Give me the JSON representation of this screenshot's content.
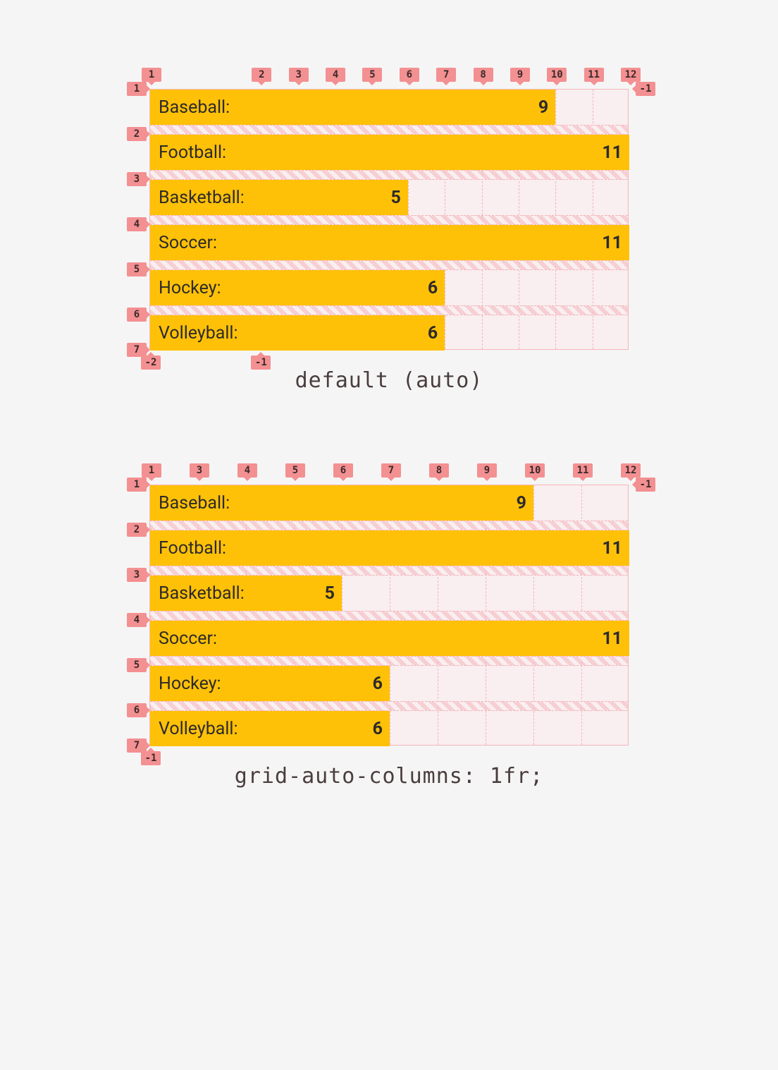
{
  "rows": [
    {
      "label": "Baseball:",
      "value": 9
    },
    {
      "label": "Football:",
      "value": 11
    },
    {
      "label": "Basketball:",
      "value": 5
    },
    {
      "label": "Soccer:",
      "value": 11
    },
    {
      "label": "Hockey:",
      "value": 6
    },
    {
      "label": "Volleyball:",
      "value": 6
    }
  ],
  "max_value": 11,
  "captions": {
    "auto": "default (auto)",
    "fr": "grid-auto-columns: 1fr;"
  },
  "diagrams": {
    "auto": {
      "label_frac": 0.23,
      "top_ticks": [
        1,
        2,
        3,
        4,
        5,
        6,
        7,
        8,
        9,
        10,
        11,
        12
      ],
      "left_ticks": [
        1,
        2,
        3,
        4,
        5,
        6,
        7
      ],
      "right_ticks": [
        -1
      ],
      "bottom_ticks": [
        -2,
        -1
      ]
    },
    "fr": {
      "label_frac": 0,
      "top_ticks": [
        1,
        3,
        4,
        5,
        6,
        7,
        8,
        9,
        10,
        11,
        12
      ],
      "left_ticks": [
        1,
        2,
        3,
        4,
        5,
        6,
        7
      ],
      "right_ticks": [
        -1
      ],
      "bottom_ticks": [
        -1
      ]
    }
  },
  "chart_data": [
    {
      "type": "bar",
      "title": "default (auto)",
      "xlabel": "",
      "ylabel": "",
      "categories": [
        "Baseball",
        "Football",
        "Basketball",
        "Soccer",
        "Hockey",
        "Volleyball"
      ],
      "values": [
        9,
        11,
        5,
        11,
        6,
        6
      ],
      "ylim": [
        0,
        11
      ],
      "note": "CSS grid overlay with auto-sized label column; numeric columns compressed toward the right; column line numbers 1..12 along top, -2 -1 along bottom, row lines 1..7 on left and -1 on right"
    },
    {
      "type": "bar",
      "title": "grid-auto-columns: 1fr;",
      "xlabel": "",
      "ylabel": "",
      "categories": [
        "Baseball",
        "Football",
        "Basketball",
        "Soccer",
        "Hockey",
        "Volleyball"
      ],
      "values": [
        9,
        11,
        5,
        11,
        6,
        6
      ],
      "ylim": [
        0,
        11
      ],
      "note": "CSS grid overlay with all 11 numeric columns equal width (1fr); column line numbers 1,3..12 along top, -1 along bottom, row lines 1..7 on left and -1 on right"
    }
  ]
}
